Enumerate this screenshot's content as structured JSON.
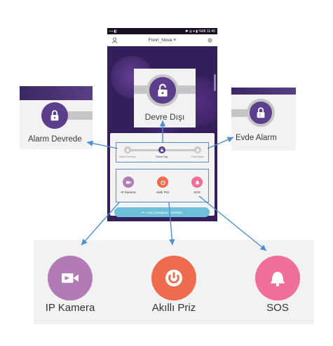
{
  "status_bar": {
    "time": "11:40",
    "battery": "%68"
  },
  "header": {
    "title": "Fonri_Nova",
    "dropdown_glyph": "≡"
  },
  "modes": [
    {
      "label": "Alarm Devrede",
      "icon": "lock-closed-icon"
    },
    {
      "label": "Devre Dışı",
      "icon": "lock-open-icon",
      "active": true
    },
    {
      "label": "Evde Alarm",
      "icon": "lock-home-icon"
    }
  ],
  "devices": [
    {
      "label": "IP Kamera",
      "icon": "video-camera-icon",
      "color": "#b27bb7"
    },
    {
      "label": "Akıllı Priz",
      "icon": "power-icon",
      "color": "#ee6b4d"
    },
    {
      "label": "SOS",
      "icon": "bell-icon",
      "color": "#ef6f9a"
    }
  ],
  "toolbar": {
    "prefix": "•••",
    "label": "Araç Çubuğunu Özelleştir"
  },
  "callouts": {
    "alarm_on": "Alarm Devrede",
    "disarmed": "Devre Dışı",
    "home_alarm": "Evde Alarm"
  },
  "colors": {
    "purple": "#5b3e8c",
    "arrow_blue": "#4b8fd4",
    "toolbar": "#6ec0d8"
  }
}
